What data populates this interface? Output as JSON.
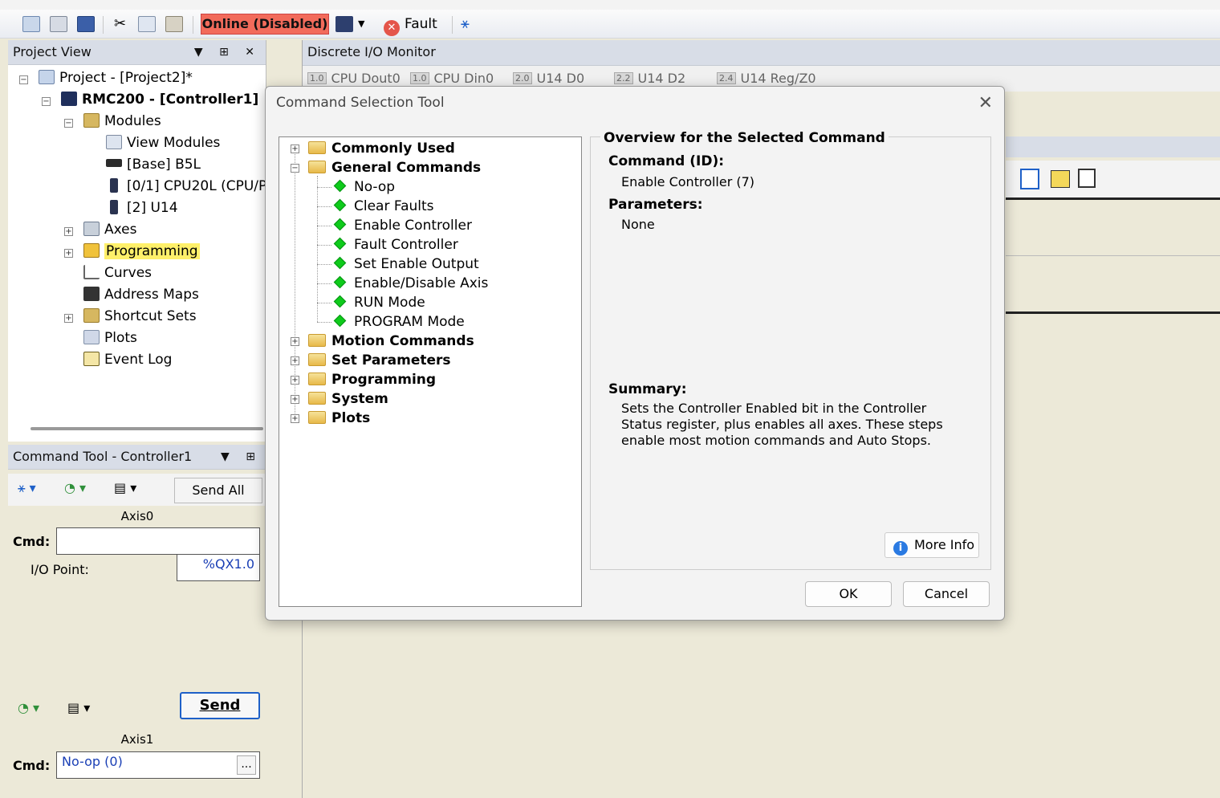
{
  "toolbar": {
    "online_status": "Online (Disabled)",
    "fault_label": "Fault"
  },
  "project_view": {
    "header": "Project View",
    "tree": [
      {
        "label": "Project - [Project2]*"
      },
      {
        "label": "RMC200 - [Controller1]"
      },
      {
        "label": "Modules"
      },
      {
        "label": "View Modules"
      },
      {
        "label": "[Base] B5L"
      },
      {
        "label": "[0/1] CPU20L (CPU/P"
      },
      {
        "label": "[2] U14"
      },
      {
        "label": "Axes"
      },
      {
        "label": "Programming"
      },
      {
        "label": "Curves"
      },
      {
        "label": "Address Maps"
      },
      {
        "label": "Shortcut Sets"
      },
      {
        "label": "Plots"
      },
      {
        "label": "Event Log"
      }
    ]
  },
  "command_tool": {
    "header": "Command Tool - Controller1",
    "send_all": "Send All",
    "axis0": {
      "label": "Axis0",
      "cmd_label": "Cmd:",
      "cmd_value": "",
      "io_label": "I/O Point:",
      "io_value": "%QX1.0"
    },
    "send": "Send",
    "axis1": {
      "label": "Axis1",
      "cmd_label": "Cmd:",
      "cmd_value": "No-op (0)",
      "browse": "..."
    }
  },
  "io_monitor": {
    "header": "Discrete I/O Monitor",
    "tabs": [
      {
        "tag": "1.0",
        "label": "CPU Dout0"
      },
      {
        "tag": "1.0",
        "label": "CPU Din0"
      },
      {
        "tag": "2.0",
        "label": "U14 D0"
      },
      {
        "tag": "2.2",
        "label": "U14 D2"
      },
      {
        "tag": "2.4",
        "label": "U14 Reg/Z0"
      }
    ]
  },
  "dialog": {
    "title": "Command Selection Tool",
    "tree": {
      "folders": [
        "Commonly Used",
        "General Commands",
        "Motion Commands",
        "Set Parameters",
        "Programming",
        "System",
        "Plots"
      ],
      "general_commands": [
        "No-op",
        "Clear Faults",
        "Enable Controller",
        "Fault Controller",
        "Set Enable Output",
        "Enable/Disable Axis",
        "RUN Mode",
        "PROGRAM Mode"
      ]
    },
    "overview": {
      "title": "Overview for the Selected Command",
      "command_label": "Command (ID):",
      "command_value": "Enable Controller (7)",
      "parameters_label": "Parameters:",
      "parameters_value": "None",
      "summary_label": "Summary:",
      "summary_text": "Sets the Controller Enabled bit in the Controller Status register, plus enables all axes. These steps enable most motion commands and Auto Stops.",
      "more_info": "More Info"
    },
    "ok": "OK",
    "cancel": "Cancel"
  }
}
